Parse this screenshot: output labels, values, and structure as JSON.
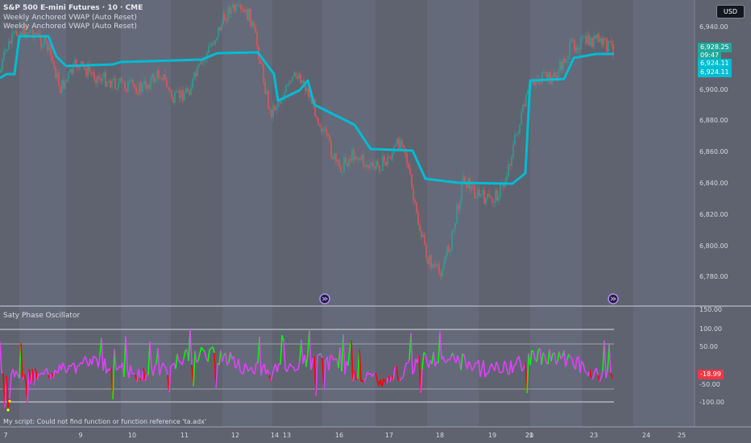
{
  "header": {
    "symbol_title": "S&P 500 E-mini Futures · 10 · CME",
    "indicator_1": "Weekly Anchored VWAP (Auto Reset)",
    "indicator_2": "Weekly Anchored VWAP (Auto Reset)"
  },
  "currency_button": "USD",
  "price_axis": {
    "ticks": [
      "6,940.00",
      "6,900.00",
      "6,880.00",
      "6,860.00",
      "6,840.00",
      "6,820.00",
      "6,800.00",
      "6,780.00"
    ],
    "last_price": "6,928.25",
    "countdown": "09:47",
    "vwap_1": "6,924.11",
    "vwap_2": "6,924.11"
  },
  "oscillator": {
    "title": "Saty Phase Oscillator",
    "ticks": [
      "150.00",
      "100.00",
      "50.00",
      "-50.00",
      "-100.00"
    ],
    "current_value": "-18.99"
  },
  "status_message": "My script: Could not find function or function reference 'ta.adx'",
  "time_axis": [
    "7",
    "9",
    "10",
    "11",
    "12",
    "13",
    "14",
    "16",
    "17",
    "18",
    "19",
    "20",
    "21",
    "23",
    "24",
    "25"
  ],
  "colors": {
    "background": "#5f6370",
    "vwap": "#00bcd4",
    "candle_up": "#26a69a",
    "candle_down": "#ef5350",
    "osc_bull": "#00ff00",
    "osc_bear": "#ff0000",
    "osc_neutral": "#e040fb",
    "osc_dots": "#ffff00",
    "last_price_tag": "#26a69a",
    "vwap_tag": "#00bcd4",
    "osc_value_tag": "#f23645"
  }
}
